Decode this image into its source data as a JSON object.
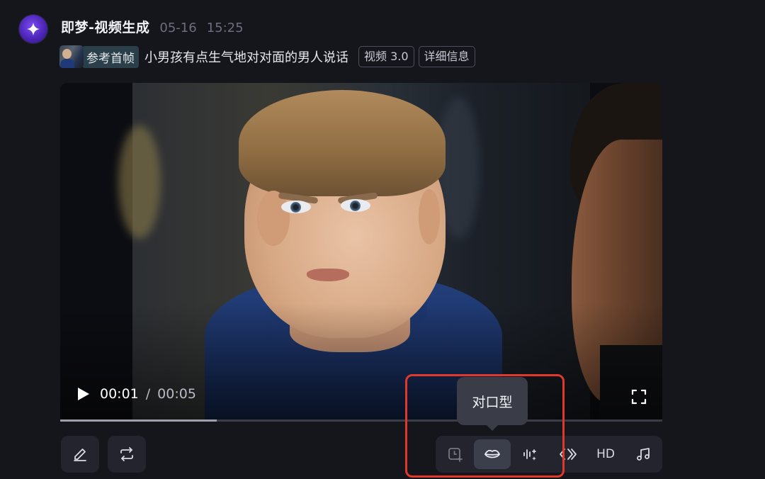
{
  "header": {
    "app_name": "即梦-视频生成",
    "date": "05-16",
    "time": "15:25"
  },
  "prompt": {
    "reference_label": "参考首帧",
    "text": "小男孩有点生气地对对面的男人说话",
    "model_chip": "视频 3.0",
    "details_chip": "详细信息"
  },
  "player": {
    "current_time": "00:01",
    "separator": "/",
    "total_time": "00:05",
    "progress": 0.26
  },
  "toolbar": {
    "hd_label": "HD",
    "tooltip": "对口型"
  },
  "icons": {
    "avatar": "sparkle-star-icon",
    "play": "play-icon",
    "fullscreen": "fullscreen-icon",
    "edit": "pencil-icon",
    "regenerate": "repeat-icon",
    "extend": "clock-plus-icon",
    "lip_sync": "lips-icon",
    "audio": "waveform-sparkle-icon",
    "interpolate": "chevron-code-icon",
    "music": "music-note-icon"
  },
  "colors": {
    "background": "#15161c",
    "accent": "#7b4df0",
    "highlight": "#e2382b"
  }
}
